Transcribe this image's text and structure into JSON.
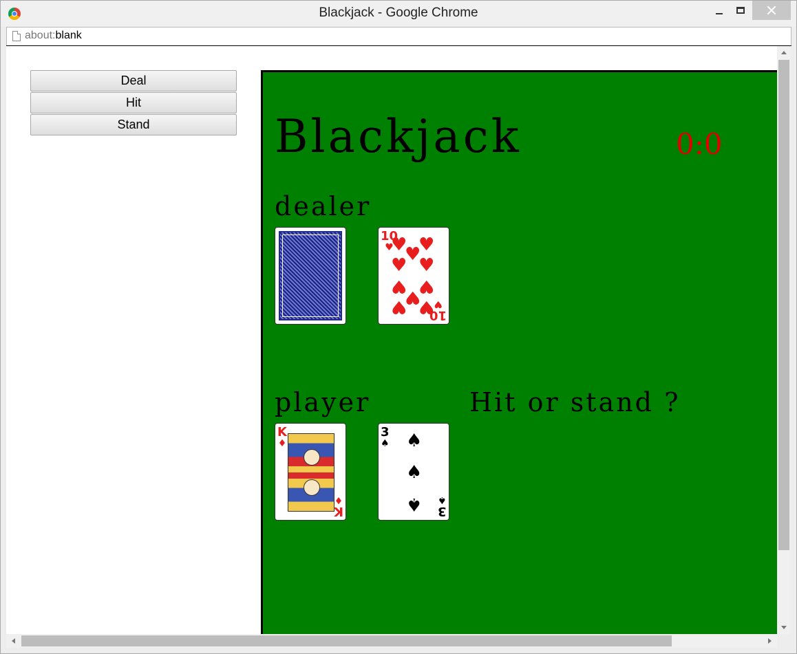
{
  "window": {
    "title": "Blackjack - Google Chrome"
  },
  "address": {
    "scheme": "about:",
    "path": "blank"
  },
  "controls": {
    "deal": "Deal",
    "hit": "Hit",
    "stand": "Stand"
  },
  "game": {
    "title": "Blackjack",
    "score": "0:0",
    "dealer_label": "dealer",
    "player_label": "player",
    "status": "Hit or stand ?",
    "colors": {
      "table": "#008000",
      "score": "#e00000",
      "red_suit": "#e81e1e"
    },
    "dealer_cards": [
      {
        "face": "back"
      },
      {
        "rank": "10",
        "suit": "♥"
      }
    ],
    "player_cards": [
      {
        "rank": "K",
        "suit": "♦"
      },
      {
        "rank": "3",
        "suit": "♠"
      }
    ]
  }
}
